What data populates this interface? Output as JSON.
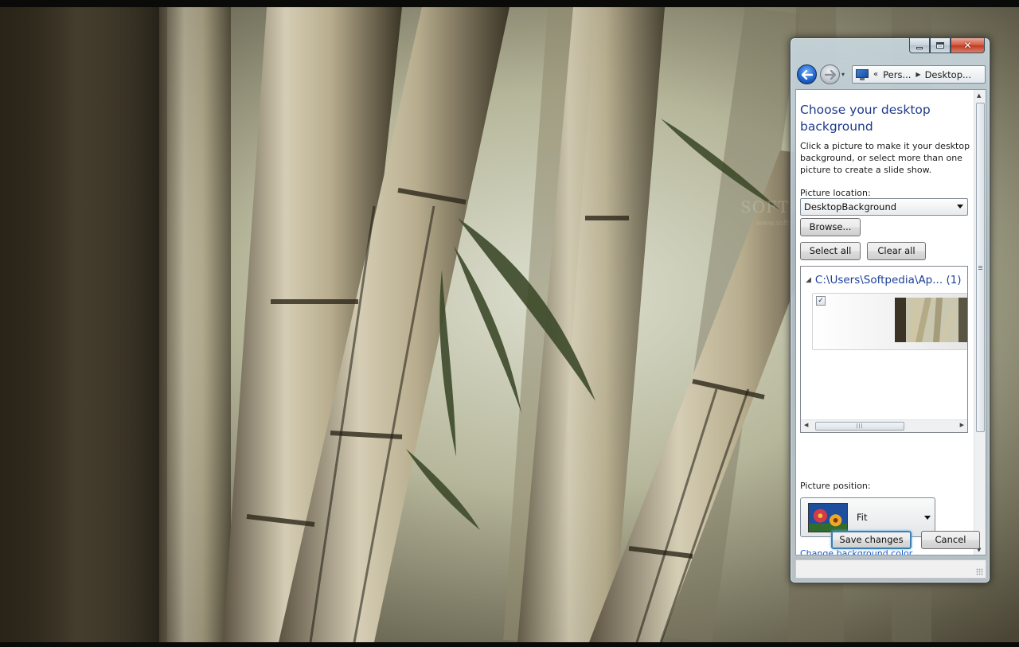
{
  "window": {
    "caption_buttons": [
      {
        "name": "minimize-button",
        "icon": "minimize-icon"
      },
      {
        "name": "maximize-button",
        "icon": "maximize-icon"
      },
      {
        "name": "close-button",
        "icon": "close-icon",
        "glyph": "✕"
      }
    ],
    "address": {
      "prefix": "«",
      "crumbs": [
        "Pers...",
        "Desktop..."
      ]
    }
  },
  "desktop": {
    "watermark": "SOFTPEDIA",
    "watermark_url": "www.softpedia.com"
  },
  "content": {
    "title": "Choose your desktop background",
    "description": "Click a picture to make it your desktop background, or select more than one picture to create a slide show.",
    "location_label": "Picture location:",
    "location_value": "DesktopBackground",
    "browse_label": "Browse...",
    "select_all_label": "Select all",
    "clear_all_label": "Clear all",
    "folder": {
      "path": "C:\\Users\\Softpedia\\Ap...",
      "count": "(1)"
    },
    "items": [
      {
        "checked": true
      }
    ],
    "position_label": "Picture position:",
    "position_value": "Fit",
    "bg_color_link": "Change background color"
  },
  "footer": {
    "save_label": "Save changes",
    "cancel_label": "Cancel"
  }
}
